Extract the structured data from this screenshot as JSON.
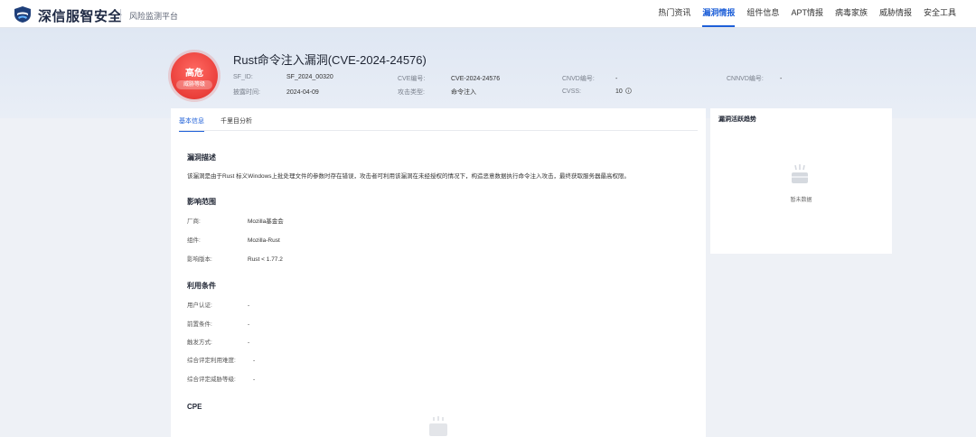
{
  "header": {
    "brand": "深信服智安全",
    "subtitle": "风险监测平台",
    "nav": [
      {
        "label": "热门资讯",
        "active": false
      },
      {
        "label": "漏洞情报",
        "active": true
      },
      {
        "label": "组件信息",
        "active": false
      },
      {
        "label": "APT情报",
        "active": false
      },
      {
        "label": "病毒家族",
        "active": false
      },
      {
        "label": "威胁情报",
        "active": false
      },
      {
        "label": "安全工具",
        "active": false
      }
    ]
  },
  "vuln": {
    "severity": "高危",
    "severity_sub": "威胁等级",
    "title": "Rust命令注入漏洞(CVE-2024-24576)",
    "meta": {
      "sf_id_label": "SF_ID:",
      "sf_id": "SF_2024_00320",
      "cve_label": "CVE编号:",
      "cve": "CVE-2024-24576",
      "cnvd_label": "CNVD编号:",
      "cnvd": "-",
      "cnnvd_label": "CNNVD编号:",
      "cnnvd": "-",
      "disclosed_label": "披露时间:",
      "disclosed": "2024-04-09",
      "attack_label": "攻击类型:",
      "attack": "命令注入",
      "cvss_label": "CVSS:",
      "cvss": "10"
    }
  },
  "main": {
    "tabs": [
      {
        "label": "基本信息",
        "active": true
      },
      {
        "label": "千里目分析",
        "active": false
      }
    ],
    "desc_title": "漏洞描述",
    "desc": "该漏洞是由于Rust 标义Windows上批处理文件的参数时存在错误，攻击者可利用该漏洞在未经授权的情况下，构造恶意数据执行命令注入攻击，最终获取服务器最高权限。",
    "scope_title": "影响范围",
    "scope": [
      {
        "k": "厂商:",
        "v": "Mozilla基金会"
      },
      {
        "k": "组件:",
        "v": "Mozilla-Rust"
      },
      {
        "k": "影响版本:",
        "v": "Rust < 1.77.2"
      }
    ],
    "cond_title": "利用条件",
    "cond": [
      {
        "k": "用户认证:",
        "v": "-"
      },
      {
        "k": "前置条件:",
        "v": "-"
      },
      {
        "k": "触发方式:",
        "v": "-"
      },
      {
        "k": "综合评定利用难度:",
        "v": "-"
      },
      {
        "k": "综合评定威胁等级:",
        "v": "-"
      }
    ],
    "cpe_title": "CPE"
  },
  "side": {
    "title": "漏洞活跃趋势",
    "empty": "暂未数据"
  },
  "colors": {
    "accent": "#1d5fd8",
    "severity": "#ea3f3a"
  }
}
